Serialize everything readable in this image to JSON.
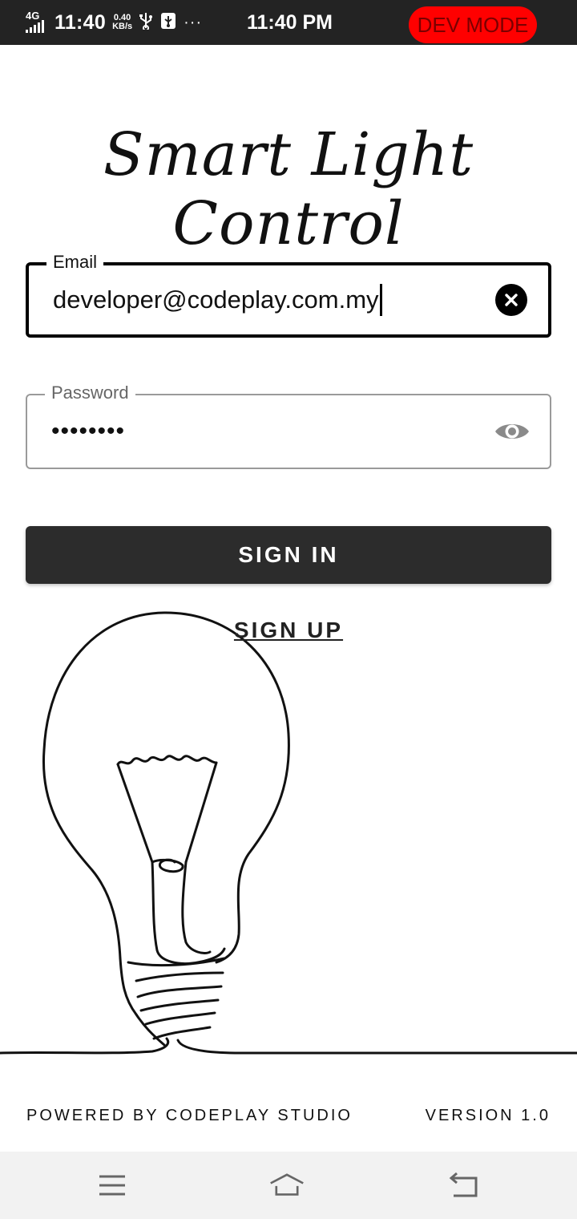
{
  "status_bar": {
    "network": "4G",
    "time_left": "11:40",
    "speed_value": "0.40",
    "speed_unit": "KB/s",
    "usb_icon": "usb-icon",
    "debug_icon": "usb-debug-icon",
    "more": "···",
    "time_center": "11:40 PM",
    "dev_mode_label": "DEV MODE",
    "dev_mode_color": "#ff0000"
  },
  "app": {
    "title": "Smart Light Control"
  },
  "form": {
    "email_label": "Email",
    "email_value": "developer@codeplay.com.my",
    "email_clear_icon": "clear-icon",
    "password_label": "Password",
    "password_value": "••••••••",
    "password_toggle_icon": "eye-icon",
    "sign_in_label": "SIGN IN",
    "sign_up_label": "SIGN UP"
  },
  "illustration": {
    "icon": "lightbulb-line-art"
  },
  "footer": {
    "powered_by": "POWERED BY CODEPLAY STUDIO",
    "version": "VERSION 1.0"
  },
  "nav_bar": {
    "menu_icon": "menu-icon",
    "home_icon": "home-icon",
    "back_icon": "back-icon"
  },
  "colors": {
    "button_bg": "#2c2c2c",
    "status_bar_bg": "#232323",
    "nav_bar_bg": "#f2f2f2"
  }
}
